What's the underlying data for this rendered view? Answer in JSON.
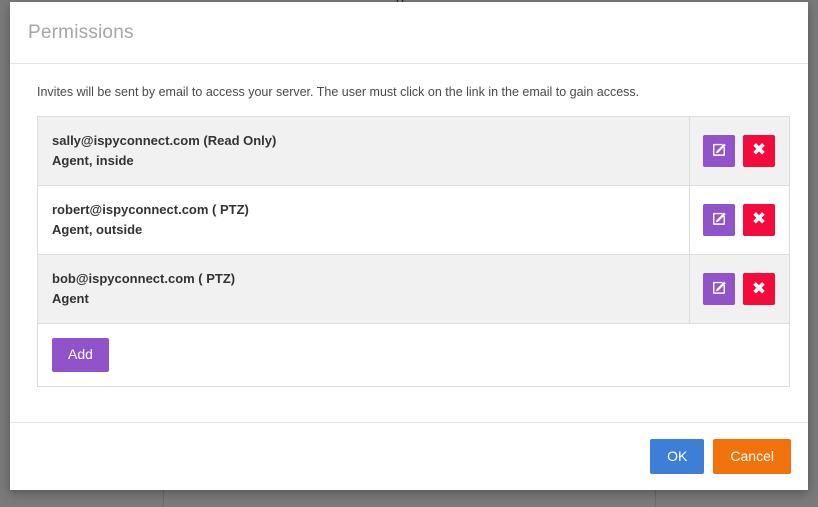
{
  "dialog": {
    "title": "Permissions",
    "intro": "Invites will be sent by email to access your server. The user must click on the link in the email to gain access.",
    "add_label": "Add",
    "ok_label": "OK",
    "cancel_label": "Cancel",
    "edit_icon": "edit-pencil-square-icon",
    "delete_icon": "close-x-icon",
    "delete_glyph": "✖"
  },
  "permissions": [
    {
      "email": "sally@ispyconnect.com (Read Only)",
      "scope": "Agent, inside"
    },
    {
      "email": "robert@ispyconnect.com ( PTZ)",
      "scope": "Agent, outside"
    },
    {
      "email": "bob@ispyconnect.com ( PTZ)",
      "scope": "Agent"
    }
  ],
  "colors": {
    "purple": "#9153c9",
    "red": "#f50a3c",
    "blue": "#3d7fd6",
    "orange": "#f2720c",
    "row_stripe": "#f1f1f1",
    "backdrop": "#7a7a7a"
  },
  "background": {
    "cut_glyph": "g"
  }
}
